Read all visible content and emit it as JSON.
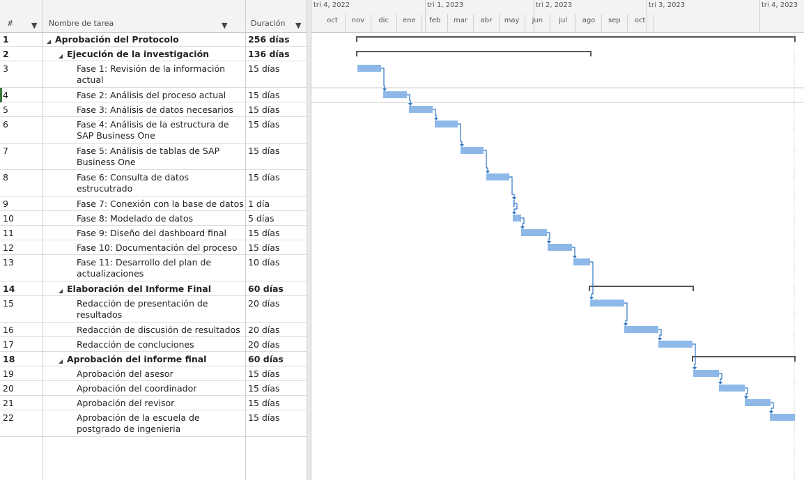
{
  "columns": {
    "id_label": "#",
    "name_label": "Nombre de tarea",
    "duration_label": "Duración"
  },
  "timescale": {
    "quarters": [
      "tri 4, 2022",
      "tri 1, 2023",
      "tri 2, 2023",
      "tri 3, 2023",
      "tri 4, 2023"
    ],
    "months": [
      "oct",
      "nov",
      "dic",
      "ene",
      "feb",
      "mar",
      "abr",
      "may",
      "jun",
      "jul",
      "ago",
      "sep",
      "oct"
    ]
  },
  "colors": {
    "task_bar": "#8db8e8",
    "summary_bar": "#555555",
    "link_arrow": "#2e75c6",
    "selected_marker": "#3b7a3b"
  },
  "tasks": [
    {
      "id": "1",
      "name": "Aprobación del Protocolo",
      "duration": "256 días",
      "level": 0,
      "summary": true
    },
    {
      "id": "2",
      "name": "Ejecución de la investigación",
      "duration": "136 días",
      "level": 1,
      "summary": true
    },
    {
      "id": "3",
      "name": "Fase 1: Revisión de la información actual",
      "duration": "15 días",
      "level": 2,
      "summary": false
    },
    {
      "id": "4",
      "name": "Fase 2: Análisis del proceso actual",
      "duration": "15 días",
      "level": 2,
      "summary": false
    },
    {
      "id": "5",
      "name": "Fase 3: Análisis de datos necesarios",
      "duration": "15 días",
      "level": 2,
      "summary": false
    },
    {
      "id": "6",
      "name": "Fase 4: Análisis de la estructura de SAP Business One",
      "duration": "15 días",
      "level": 2,
      "summary": false
    },
    {
      "id": "7",
      "name": "Fase 5: Análisis de tablas de SAP Business One",
      "duration": "15 días",
      "level": 2,
      "summary": false
    },
    {
      "id": "8",
      "name": "Fase 6: Consulta de datos estrucutrado",
      "duration": "15 días",
      "level": 2,
      "summary": false
    },
    {
      "id": "9",
      "name": "Fase 7: Conexión con la base de datos",
      "duration": "1 día",
      "level": 2,
      "summary": false
    },
    {
      "id": "10",
      "name": "Fase 8: Modelado de datos",
      "duration": "5 días",
      "level": 2,
      "summary": false
    },
    {
      "id": "11",
      "name": "Fase 9: Diseño del dashboard final",
      "duration": "15 días",
      "level": 2,
      "summary": false
    },
    {
      "id": "12",
      "name": "Fase 10: Documentación del proceso",
      "duration": "15 días",
      "level": 2,
      "summary": false
    },
    {
      "id": "13",
      "name": "Fase 11: Desarrollo del plan de actualizaciones",
      "duration": "10 días",
      "level": 2,
      "summary": false
    },
    {
      "id": "14",
      "name": "Elaboración del Informe Final",
      "duration": "60 días",
      "level": 1,
      "summary": true
    },
    {
      "id": "15",
      "name": "Redacción de presentación de resultados",
      "duration": "20 días",
      "level": 2,
      "summary": false
    },
    {
      "id": "16",
      "name": "Redacción de discusión de resultados",
      "duration": "20 días",
      "level": 2,
      "summary": false
    },
    {
      "id": "17",
      "name": "Redacción de concluciones",
      "duration": "20 días",
      "level": 2,
      "summary": false
    },
    {
      "id": "18",
      "name": "Aprobación del informe final",
      "duration": "60 días",
      "level": 1,
      "summary": true
    },
    {
      "id": "19",
      "name": "Aprobación del asesor",
      "duration": "15 días",
      "level": 2,
      "summary": false
    },
    {
      "id": "20",
      "name": "Aprobación del coordinador",
      "duration": "15 días",
      "level": 2,
      "summary": false
    },
    {
      "id": "21",
      "name": "Aprobación del revisor",
      "duration": "15 días",
      "level": 2,
      "summary": false
    },
    {
      "id": "22",
      "name": "Aprobación de la escuela de postgrado de ingenieria",
      "duration": "15 días",
      "level": 2,
      "summary": false
    }
  ]
}
